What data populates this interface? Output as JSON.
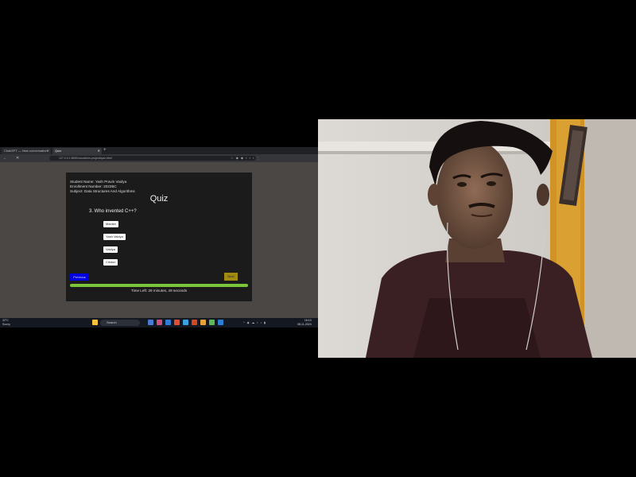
{
  "browser": {
    "tabs": [
      {
        "label": "ChatGPT — New conversation",
        "active": false
      },
      {
        "label": "Quiz",
        "active": true
      }
    ],
    "new_tab": "+",
    "back": "←",
    "reload": "✕",
    "url": "127.0.0.1:5500/vscode/cs-project/quiz.html"
  },
  "quiz": {
    "student_name": "Student Name: Yash Pravin Vaidya",
    "enrollment": "Enrollment Number: 2022BC",
    "subject": "Subject: Data Structures And Algorithms",
    "title": "Quiz",
    "question": "3. Who invented C++?",
    "options": [
      "Manish",
      "Yash Vaidya",
      "Vaidya",
      "Clinton"
    ],
    "previous_label": "Previous",
    "next_label": "Next",
    "progress": 1.0,
    "timer_text": "Time Left: 29 minutes, 49 seconds"
  },
  "taskbar": {
    "weather": "32°C",
    "weather_sub": "Sunny",
    "search_label": "Search",
    "time": "16:10",
    "date": "08-11-2024"
  },
  "colors": {
    "previous_button": "#0000e0",
    "next_button": "#a08a10",
    "progress_fill": "#7ac63a",
    "card_bg": "#1b1b1b"
  }
}
